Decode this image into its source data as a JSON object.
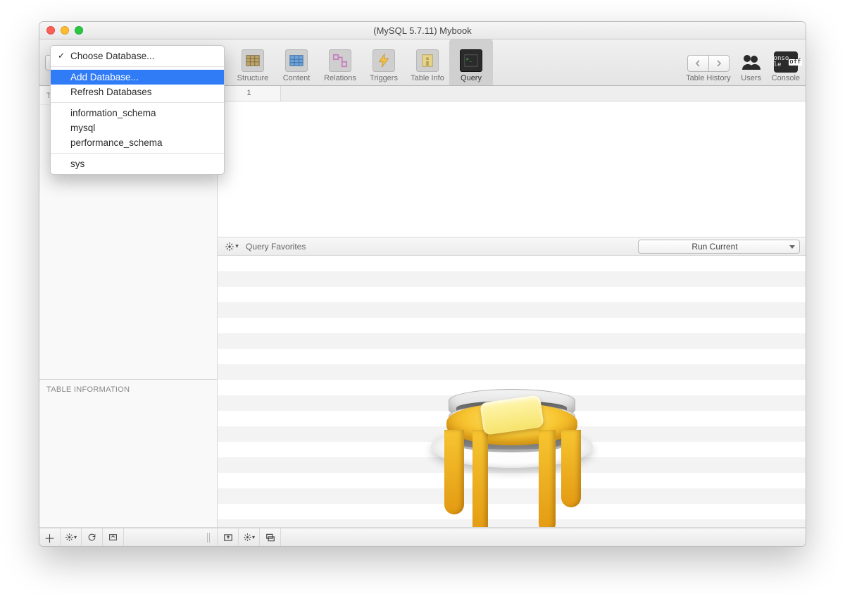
{
  "window": {
    "title": "(MySQL 5.7.11) Mybook"
  },
  "toolbar": {
    "items": [
      {
        "label": "Structure"
      },
      {
        "label": "Content"
      },
      {
        "label": "Relations"
      },
      {
        "label": "Triggers"
      },
      {
        "label": "Table Info"
      },
      {
        "label": "Query"
      }
    ],
    "active_index": 5,
    "right": {
      "history_label": "Table History",
      "users_label": "Users",
      "console_label": "Console",
      "console_text": "conso\nle off"
    }
  },
  "sidebar": {
    "tables_heading": "TABLES",
    "info_heading": "TABLE INFORMATION"
  },
  "tabstrip": {
    "tab1_label": "1"
  },
  "querybar": {
    "favorites_label": "Query Favorites",
    "run_label": "Run Current"
  },
  "dropdown": {
    "title": "Choose Database...",
    "add": "Add Database...",
    "refresh": "Refresh Databases",
    "databases": [
      "information_schema",
      "mysql",
      "performance_schema"
    ],
    "databases2": [
      "sys"
    ]
  }
}
